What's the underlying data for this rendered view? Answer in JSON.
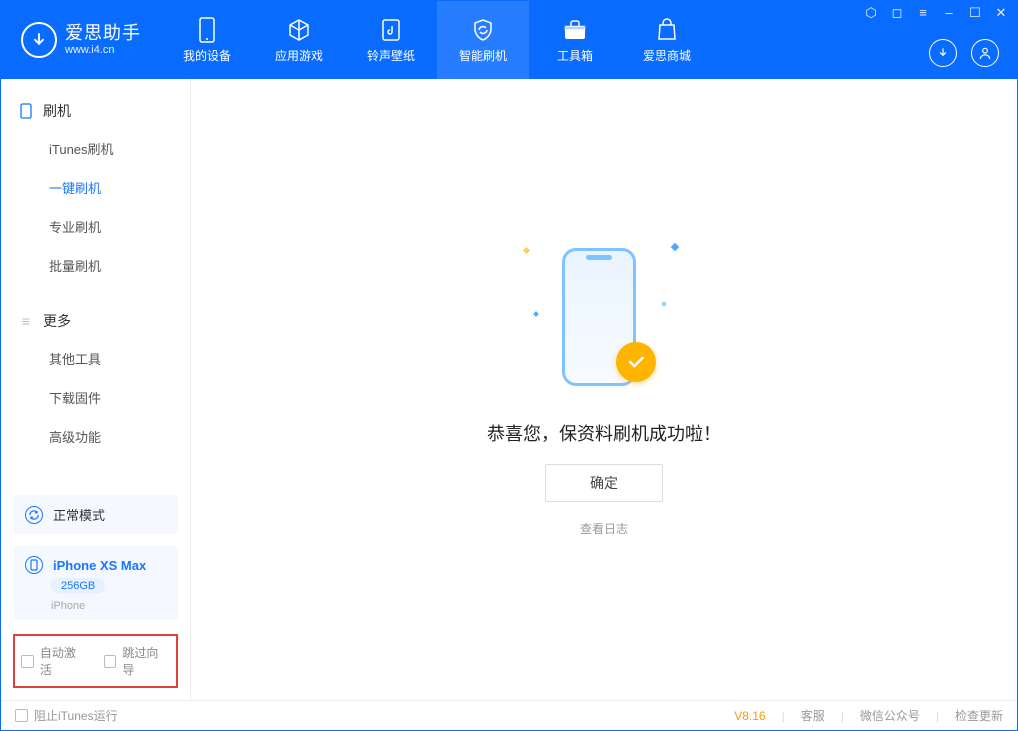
{
  "logo": {
    "name": "爱思助手",
    "url": "www.i4.cn"
  },
  "nav": [
    {
      "label": "我的设备"
    },
    {
      "label": "应用游戏"
    },
    {
      "label": "铃声壁纸"
    },
    {
      "label": "智能刷机"
    },
    {
      "label": "工具箱"
    },
    {
      "label": "爱思商城"
    }
  ],
  "sidebar": {
    "group1": {
      "title": "刷机",
      "items": [
        {
          "label": "iTunes刷机"
        },
        {
          "label": "一键刷机"
        },
        {
          "label": "专业刷机"
        },
        {
          "label": "批量刷机"
        }
      ]
    },
    "group2": {
      "title": "更多",
      "items": [
        {
          "label": "其他工具"
        },
        {
          "label": "下载固件"
        },
        {
          "label": "高级功能"
        }
      ]
    },
    "mode": {
      "label": "正常模式"
    },
    "device": {
      "name": "iPhone XS Max",
      "storage": "256GB",
      "type": "iPhone"
    },
    "checkboxes": {
      "auto_activate": "自动激活",
      "skip_guide": "跳过向导"
    }
  },
  "main": {
    "success_text": "恭喜您，保资料刷机成功啦！",
    "confirm": "确定",
    "log_link": "查看日志"
  },
  "footer": {
    "block_itunes": "阻止iTunes运行",
    "version": "V8.16",
    "links": {
      "service": "客服",
      "wechat": "微信公众号",
      "update": "检查更新"
    }
  }
}
